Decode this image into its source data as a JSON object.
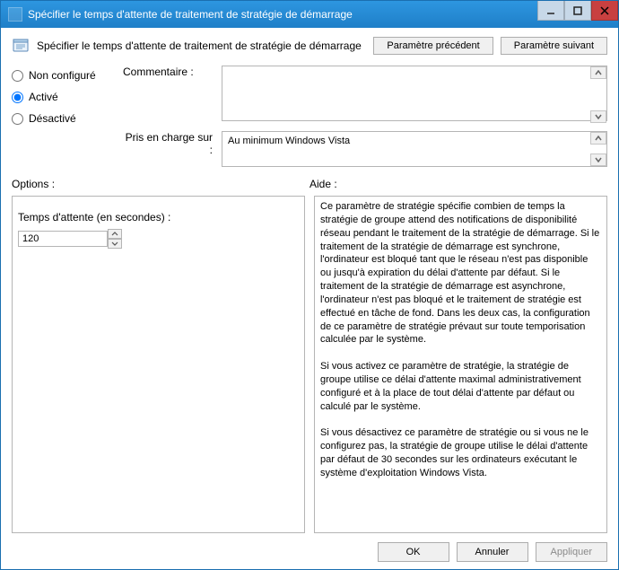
{
  "window": {
    "title": "Spécifier le temps d'attente de traitement de stratégie de démarrage"
  },
  "header": {
    "policy_title": "Spécifier le temps d'attente de traitement de stratégie de démarrage",
    "prev_btn": "Paramètre précédent",
    "next_btn": "Paramètre suivant"
  },
  "state": {
    "not_configured": "Non configuré",
    "enabled": "Activé",
    "disabled": "Désactivé",
    "selected": "enabled"
  },
  "fields": {
    "comment_label": "Commentaire :",
    "comment_value": "",
    "supported_label": "Pris en charge sur :",
    "supported_value": "Au minimum Windows Vista"
  },
  "sections": {
    "options_label": "Options :",
    "help_label": "Aide :"
  },
  "options": {
    "wait_label": "Temps d'attente (en secondes) :",
    "wait_value": "120"
  },
  "help_text": "Ce paramètre de stratégie spécifie combien de temps la stratégie de groupe attend des notifications de disponibilité réseau pendant le traitement de la stratégie de démarrage. Si le traitement de la stratégie de démarrage est synchrone, l'ordinateur est bloqué tant que le réseau n'est pas disponible ou jusqu'à expiration du délai d'attente par défaut. Si le traitement de la stratégie de démarrage est asynchrone, l'ordinateur n'est pas bloqué et le traitement de stratégie est effectué en tâche de fond. Dans les deux cas, la configuration de ce paramètre de stratégie prévaut sur toute temporisation calculée par le système.\n\nSi vous activez ce paramètre de stratégie, la stratégie de groupe utilise ce délai d'attente maximal administrativement configuré et à la place de tout délai d'attente par défaut ou calculé par le système.\n\nSi vous désactivez ce paramètre de stratégie ou si vous ne le configurez pas, la stratégie de groupe utilise le délai d'attente par défaut de 30 secondes sur les ordinateurs exécutant le système d'exploitation Windows Vista.",
  "footer": {
    "ok": "OK",
    "cancel": "Annuler",
    "apply": "Appliquer"
  }
}
